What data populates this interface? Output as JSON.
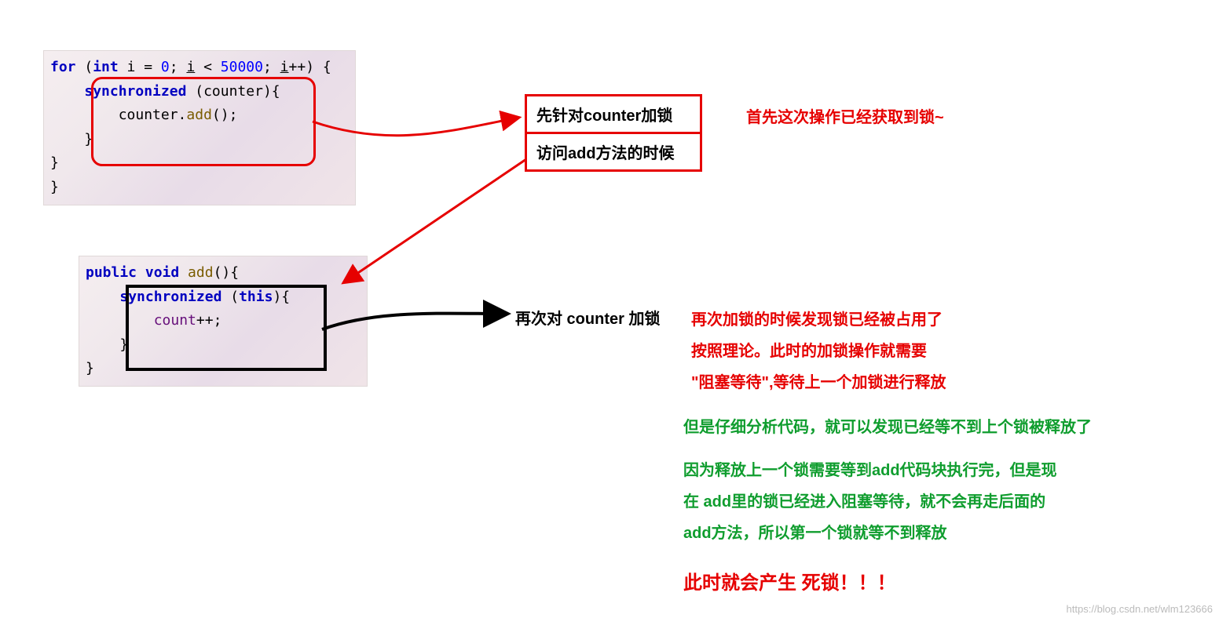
{
  "code1": {
    "l1a": "for",
    "l1b": " (",
    "l1c": "int",
    "l1d": " i = ",
    "l1e": "0",
    "l1f": "; ",
    "l1g": "i",
    "l1h": " < ",
    "l1i": "50000",
    "l1j": "; ",
    "l1k": "i",
    "l1l": "++) {",
    "l2a": "    ",
    "l2b": "synchronized",
    "l2c": " (counter){",
    "l3a": "        counter.",
    "l3b": "add",
    "l3c": "();",
    "l4": "    }",
    "l5": "}",
    "l6": "}"
  },
  "code2": {
    "l1a": "public void",
    "l1b": " add",
    "l1c": "(){",
    "l2a": "    ",
    "l2b": "synchronized",
    "l2c": " (",
    "l2d": "this",
    "l2e": "){",
    "l3a": "        ",
    "l3b": "count",
    "l3c": "++;",
    "l4": "    }",
    "l5": "}"
  },
  "ann_box": {
    "line1": "先针对counter加锁",
    "line2": "访问add方法的时候"
  },
  "ann_right_top": "首先这次操作已经获取到锁~",
  "ann_black": "再次对 counter 加锁",
  "ann_red_block": "再次加锁的时候发现锁已经被占用了\n按照理论。此时的加锁操作就需要\n\"阻塞等待\",等待上一个加锁进行释放",
  "ann_green1": "但是仔细分析代码，就可以发现已经等不到上个锁被释放了",
  "ann_green2": "因为释放上一个锁需要等到add代码块执行完，但是现\n在 add里的锁已经进入阻塞等待，就不会再走后面的\nadd方法，所以第一个锁就等不到释放",
  "ann_deadlock": "此时就会产生  死锁！！！",
  "watermark": "https://blog.csdn.net/wlm123666"
}
